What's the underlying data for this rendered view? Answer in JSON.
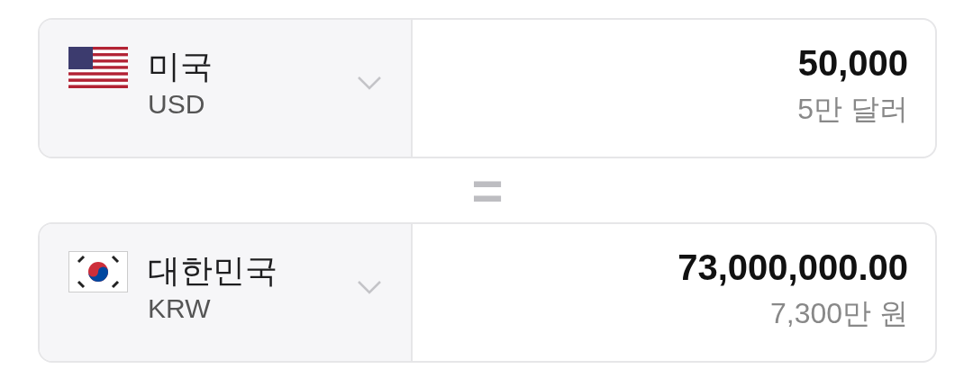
{
  "rows": [
    {
      "country": "미국",
      "code": "USD",
      "amount": "50,000",
      "amount_words": "5만 달러"
    },
    {
      "country": "대한민국",
      "code": "KRW",
      "amount": "73,000,000.00",
      "amount_words": "7,300만 원"
    }
  ],
  "separator": "="
}
